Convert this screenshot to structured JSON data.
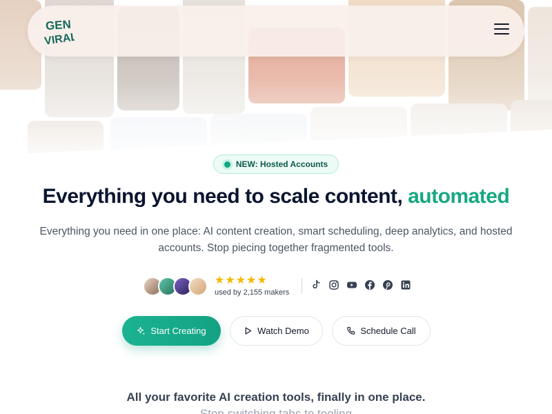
{
  "brand": {
    "logo_text_top": "GEN",
    "logo_text_bottom": "VIRAL",
    "logo_color": "#17695a"
  },
  "nav": {
    "menu_icon": "hamburger-menu-icon"
  },
  "hero": {
    "badge_label": "NEW: Hosted Accounts",
    "headline_main": "Everything you need to scale content, ",
    "headline_accent": "automated",
    "subtitle": "Everything you need in one place: AI content creation, smart scheduling, deep analytics, and hosted accounts. Stop piecing together fragmented tools.",
    "accent_color": "#17a883"
  },
  "social_proof": {
    "stars": "★★★★★",
    "rating_value": 5,
    "used_by": "used by 2,155 makers",
    "platforms": [
      "tiktok-icon",
      "instagram-icon",
      "youtube-icon",
      "facebook-icon",
      "pinterest-icon",
      "linkedin-icon"
    ]
  },
  "actions": {
    "start_creating": "Start Creating",
    "watch_demo": "Watch Demo",
    "schedule_call": "Schedule Call"
  },
  "features": {
    "title": "All your favorite AI creation tools, finally in one place.",
    "subtitle_partial": "Stop switching tabs to tooling"
  }
}
